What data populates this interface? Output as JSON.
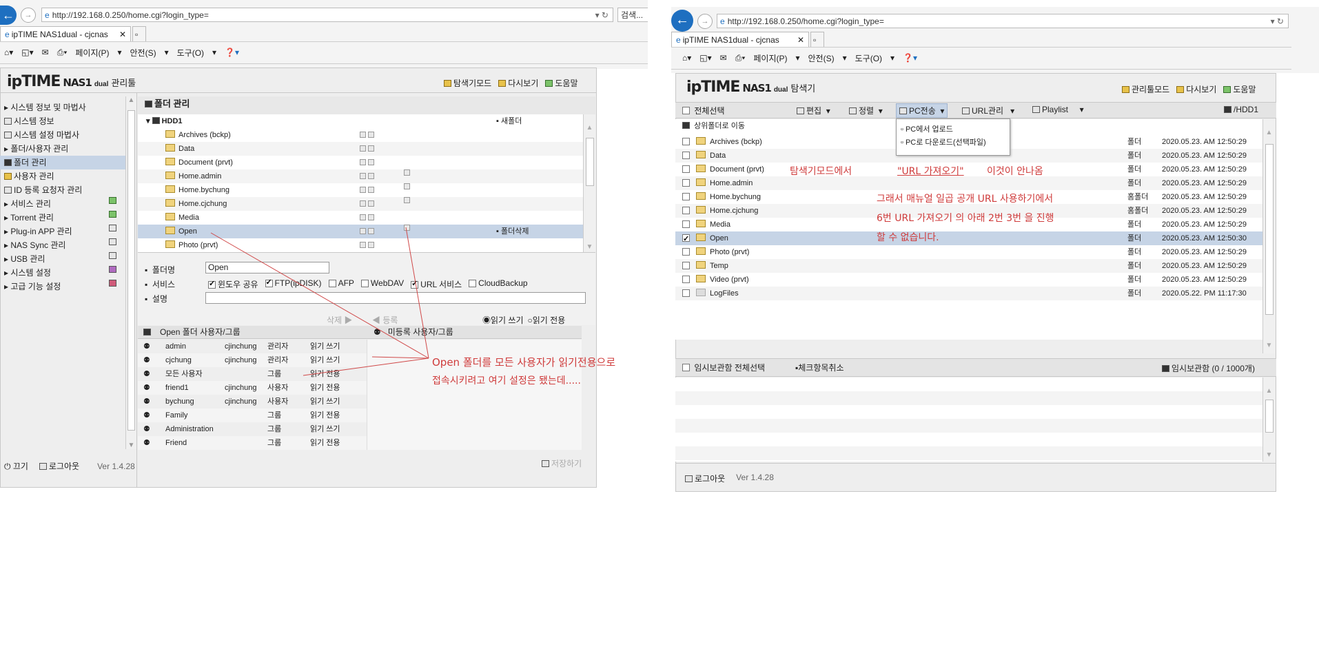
{
  "left": {
    "url": "http://192.168.0.250/home.cgi?login_type=",
    "search_label": "검색...",
    "tab_title": "ipTIME NAS1dual - cjcnas",
    "menu": {
      "page": "페이지(P)",
      "safety": "안전(S)",
      "tools": "도구(O)"
    },
    "app_title_brand": "ipTIME",
    "app_title_model": "NAS1",
    "app_title_dual": "dual",
    "app_title_suffix": "관리툴",
    "top_links": [
      "탐색기모드",
      "다시보기",
      "도움말"
    ],
    "nav": [
      "시스템 정보 및 마법사",
      "시스템 정보",
      "시스템 설정 마법사",
      "폴더/사용자 관리",
      "폴더 관리",
      "사용자 관리",
      "ID 등록 요청자 관리",
      "서비스 관리",
      "Torrent 관리",
      "Plug-in APP 관리",
      "NAS Sync 관리",
      "USB 관리",
      "시스템 설정",
      "고급 기능 설정"
    ],
    "section_title": "폴더 관리",
    "hdd": "HDD1",
    "new_folder": "새폴더",
    "delete_folder": "폴더삭제",
    "folders": [
      "Archives (bckp)",
      "Data",
      "Document (prvt)",
      "Home.admin",
      "Home.bychung",
      "Home.cjchung",
      "Media",
      "Open",
      "Photo (prvt)"
    ],
    "form": {
      "name_label": "폴더명",
      "name_value": "Open",
      "service_label": "서비스",
      "services": [
        "윈도우 공유",
        "FTP(ipDISK)",
        "AFP",
        "WebDAV",
        "URL 서비스",
        "CloudBackup"
      ],
      "desc_label": "설명"
    },
    "delete_btn": "삭제",
    "register_btn": "등록",
    "radio_rw": "읽기 쓰기",
    "radio_ro": "읽기 전용",
    "users_header": "Open 폴더 사용자/그룹",
    "unreg_header": "미등록 사용자/그룹",
    "users": [
      {
        "name": "admin",
        "owner": "cjinchung",
        "type": "관리자",
        "perm": "읽기 쓰기"
      },
      {
        "name": "cjchung",
        "owner": "cjinchung",
        "type": "관리자",
        "perm": "읽기 쓰기"
      },
      {
        "name": "모든 사용자",
        "owner": "",
        "type": "그룹",
        "perm": "읽기 전용"
      },
      {
        "name": "friend1",
        "owner": "cjinchung",
        "type": "사용자",
        "perm": "읽기 전용"
      },
      {
        "name": "bychung",
        "owner": "cjinchung",
        "type": "사용자",
        "perm": "읽기 쓰기"
      },
      {
        "name": "Family",
        "owner": "",
        "type": "그룹",
        "perm": "읽기 전용"
      },
      {
        "name": "Administration",
        "owner": "",
        "type": "그룹",
        "perm": "읽기 쓰기"
      },
      {
        "name": "Friend",
        "owner": "",
        "type": "그룹",
        "perm": "읽기 전용"
      }
    ],
    "save_btn": "저장하기",
    "footer": {
      "off": "끄기",
      "logout": "로그아웃",
      "version": "Ver 1.4.28"
    },
    "annotation_line1": "Open 폴더를 모든 사용자가 읽기전용으로",
    "annotation_line2": "접속시키려고 여기 설정은 됐는데....."
  },
  "right": {
    "url": "http://192.168.0.250/home.cgi?login_type=",
    "tab_title": "ipTIME NAS1dual - cjcnas",
    "menu": {
      "page": "페이지(P)",
      "safety": "안전(S)",
      "tools": "도구(O)"
    },
    "app_title_suffix": "탐색기",
    "top_links": [
      "관리툴모드",
      "다시보기",
      "도움말"
    ],
    "toolbar": {
      "select_all": "전체선택",
      "edit": "편집",
      "sort": "정렬",
      "pc": "PC전송",
      "url": "URL관리",
      "playlist": "Playlist",
      "path": "/HDD1"
    },
    "dropdown": [
      "PC에서 업로드",
      "PC로 다운로드(선택파일)"
    ],
    "up_folder": "상위폴더로 이동",
    "files": [
      {
        "name": "Archives (bckp)",
        "type": "폴더",
        "date": "2020.05.23. AM 12:50:29"
      },
      {
        "name": "Data",
        "type": "폴더",
        "date": "2020.05.23. AM 12:50:29"
      },
      {
        "name": "Document (prvt)",
        "type": "폴더",
        "date": "2020.05.23. AM 12:50:29"
      },
      {
        "name": "Home.admin",
        "type": "폴더",
        "date": "2020.05.23. AM 12:50:29"
      },
      {
        "name": "Home.bychung",
        "type": "홈폴더",
        "date": "2020.05.23. AM 12:50:29"
      },
      {
        "name": "Home.cjchung",
        "type": "홈폴더",
        "date": "2020.05.23. AM 12:50:29"
      },
      {
        "name": "Media",
        "type": "폴더",
        "date": "2020.05.23. AM 12:50:29"
      },
      {
        "name": "Open",
        "type": "폴더",
        "date": "2020.05.23. AM 12:50:30"
      },
      {
        "name": "Photo (prvt)",
        "type": "폴더",
        "date": "2020.05.23. AM 12:50:29"
      },
      {
        "name": "Temp",
        "type": "폴더",
        "date": "2020.05.23. AM 12:50:29"
      },
      {
        "name": "Video (prvt)",
        "type": "폴더",
        "date": "2020.05.23. AM 12:50:29"
      },
      {
        "name": "LogFiles",
        "type": "폴더",
        "date": "2020.05.22. PM 11:17:30"
      }
    ],
    "annotation_a": "탐색기모드에서",
    "annotation_b": "\"URL 가져오기\"",
    "annotation_c": "이것이 안나옴",
    "annotation_d": "그래서   매뉴얼 일곱 공개 URL 사용하기에서",
    "annotation_e": "6번 URL 가져오기 의 아래 2번 3번 을 진행",
    "annotation_f": "할 수 없습니다.",
    "temp_select_all": "임시보관함 전체선택",
    "temp_uncheck": "체크항목취소",
    "temp_box": "임시보관함 (0 / 1000개)",
    "footer_logout": "로그아웃",
    "footer_version": "Ver 1.4.28"
  }
}
